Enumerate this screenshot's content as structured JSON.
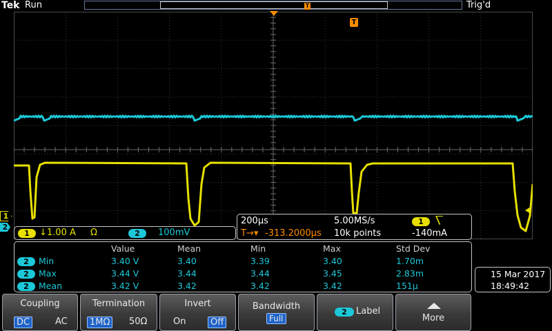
{
  "status": {
    "brand": "Tek",
    "run_state": "Run",
    "trigger_state": "Trig'd",
    "trigger_marker": "T"
  },
  "colors": {
    "ch1": "#e8e000",
    "ch2": "#1cc8d8",
    "trigger": "#ff8c00"
  },
  "channels": {
    "ch1": {
      "number": "1",
      "scale": "↓1.00 A",
      "impedance": "Ω"
    },
    "ch2": {
      "number": "2",
      "scale": "100mV"
    }
  },
  "timebase": {
    "scale": "200μs",
    "sample_rate": "5.00MS/s",
    "record_length": "10k points",
    "position": "-313.2000μs",
    "position_prefix": "T→▾",
    "trigger_source": "1",
    "trigger_slope": "⎲",
    "trigger_level": "-140mA"
  },
  "measurements": {
    "headers": [
      "Value",
      "Mean",
      "Min",
      "Max",
      "Std Dev"
    ],
    "rows": [
      {
        "ch": "2",
        "name": "Min",
        "value": "3.40 V",
        "mean": "3.40",
        "min": "3.39",
        "max": "3.40",
        "std": "1.70m"
      },
      {
        "ch": "2",
        "name": "Max",
        "value": "3.44 V",
        "mean": "3.44",
        "min": "3.44",
        "max": "3.45",
        "std": "2.83m"
      },
      {
        "ch": "2",
        "name": "Mean",
        "value": "3.42 V",
        "mean": "3.42",
        "min": "3.42",
        "max": "3.42",
        "std": "151μ"
      }
    ]
  },
  "datetime": {
    "date": "15 Mar  2017",
    "time": "18:49:42"
  },
  "menu": {
    "coupling": {
      "label": "Coupling",
      "options": [
        "DC",
        "AC"
      ],
      "selected": "DC"
    },
    "termination": {
      "label": "Termination",
      "options": [
        "1MΩ",
        "50Ω"
      ],
      "selected": "1MΩ"
    },
    "invert": {
      "label": "Invert",
      "options": [
        "On",
        "Off"
      ],
      "selected": "Off"
    },
    "bandwidth": {
      "label": "Bandwidth",
      "value": "Full"
    },
    "label_btn": {
      "ch": "2",
      "label": "Label"
    },
    "more": {
      "label": "More",
      "icon": "up-arrow-icon"
    }
  }
}
